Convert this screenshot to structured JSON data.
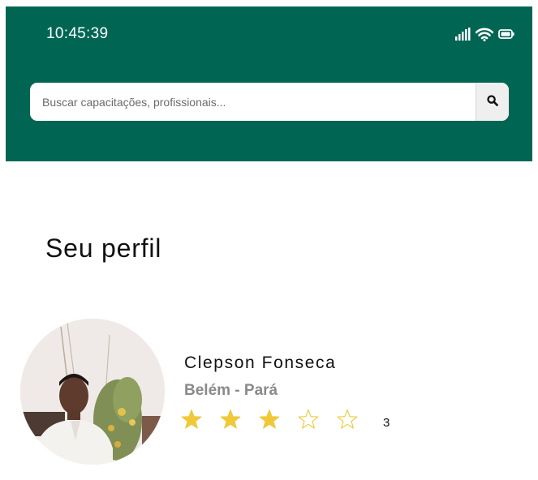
{
  "status_bar": {
    "time": "10:45:39",
    "icons": [
      "signal-icon",
      "wifi-icon",
      "battery-icon"
    ]
  },
  "search": {
    "placeholder": "Buscar capacitações, profissionais...",
    "value": "",
    "button_icon": "search-icon"
  },
  "page": {
    "title": "Seu perfil"
  },
  "profile": {
    "name": "Clepson Fonseca",
    "location": "Belém - Pará",
    "rating": {
      "filled_stars": 3,
      "max_stars": 5,
      "count": "3"
    }
  },
  "colors": {
    "header_background": "#006653",
    "star_filled": "#efc93a",
    "star_outline": "#efc93a",
    "location_text": "#8a8a8a"
  }
}
